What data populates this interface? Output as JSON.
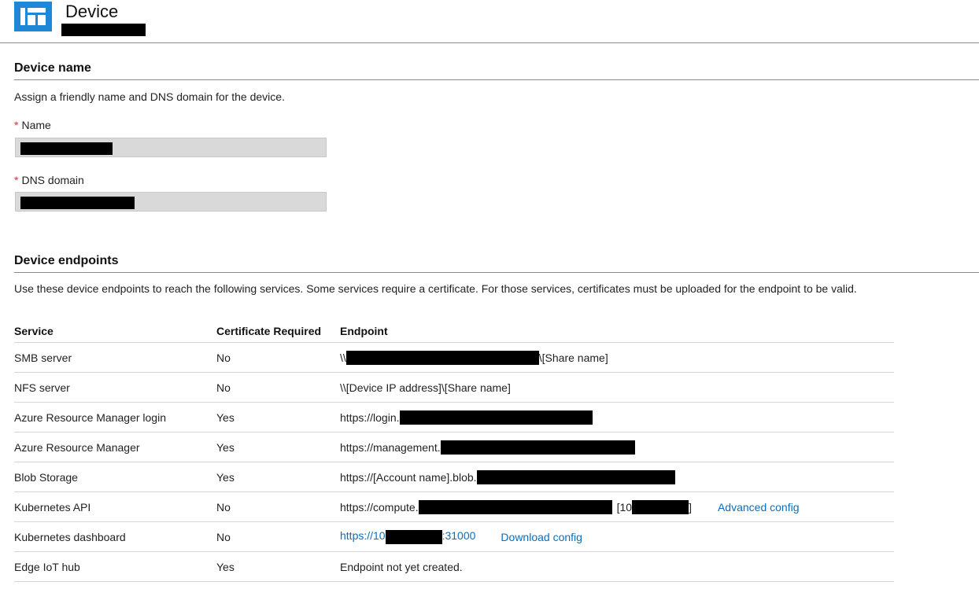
{
  "header": {
    "title": "Device"
  },
  "device_name": {
    "heading": "Device name",
    "description": "Assign a friendly name and DNS domain for the device.",
    "name_label": "Name",
    "dns_label": "DNS domain",
    "required_mark": "*"
  },
  "endpoints": {
    "heading": "Device endpoints",
    "description": "Use these device endpoints to reach the following services. Some services require a certificate. For those services, certificates must be uploaded for the endpoint to be valid.",
    "columns": [
      "Service",
      "Certificate Required",
      "Endpoint"
    ],
    "rows": [
      {
        "service": "SMB server",
        "cert": "No",
        "ep_pre": "\\\\",
        "ep_post": "\\[Share name]"
      },
      {
        "service": "NFS server",
        "cert": "No",
        "ep_full": "\\\\[Device IP address]\\[Share name]"
      },
      {
        "service": "Azure Resource Manager login",
        "cert": "Yes",
        "ep_pre": "https://login."
      },
      {
        "service": "Azure Resource Manager",
        "cert": "Yes",
        "ep_pre": "https://management."
      },
      {
        "service": "Blob Storage",
        "cert": "Yes",
        "ep_pre": "https://[Account name].blob."
      },
      {
        "service": "Kubernetes API",
        "cert": "No",
        "ep_pre": "https://compute.",
        "ep_mid": "[10",
        "ep_post": "]",
        "action": "Advanced config"
      },
      {
        "service": "Kubernetes dashboard",
        "cert": "No",
        "ep_pre": "https://10",
        "ep_post": ":31000",
        "action": "Download config"
      },
      {
        "service": "Edge IoT hub",
        "cert": "Yes",
        "ep_full": "Endpoint not yet created."
      }
    ]
  }
}
